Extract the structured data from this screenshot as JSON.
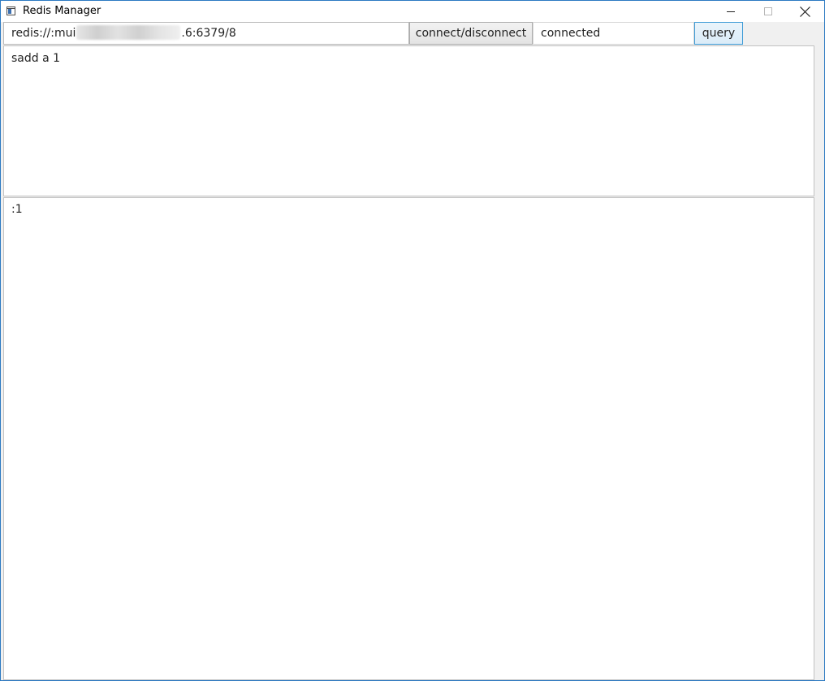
{
  "window": {
    "title": "Redis Manager"
  },
  "toolbar": {
    "url_prefix": "redis://:mui",
    "url_suffix": ".6:6379/8",
    "connect_label": "connect/disconnect",
    "status": "connected",
    "query_label": "query"
  },
  "editor": {
    "query_text": "sadd a 1"
  },
  "output": {
    "result_text": ":1"
  },
  "icons": {
    "app": "app-window-icon",
    "minimize": "minimize-icon",
    "maximize": "maximize-icon",
    "close": "close-icon"
  },
  "colors": {
    "window_border": "#2b79c2",
    "query_button_border": "#3c9ad6"
  }
}
